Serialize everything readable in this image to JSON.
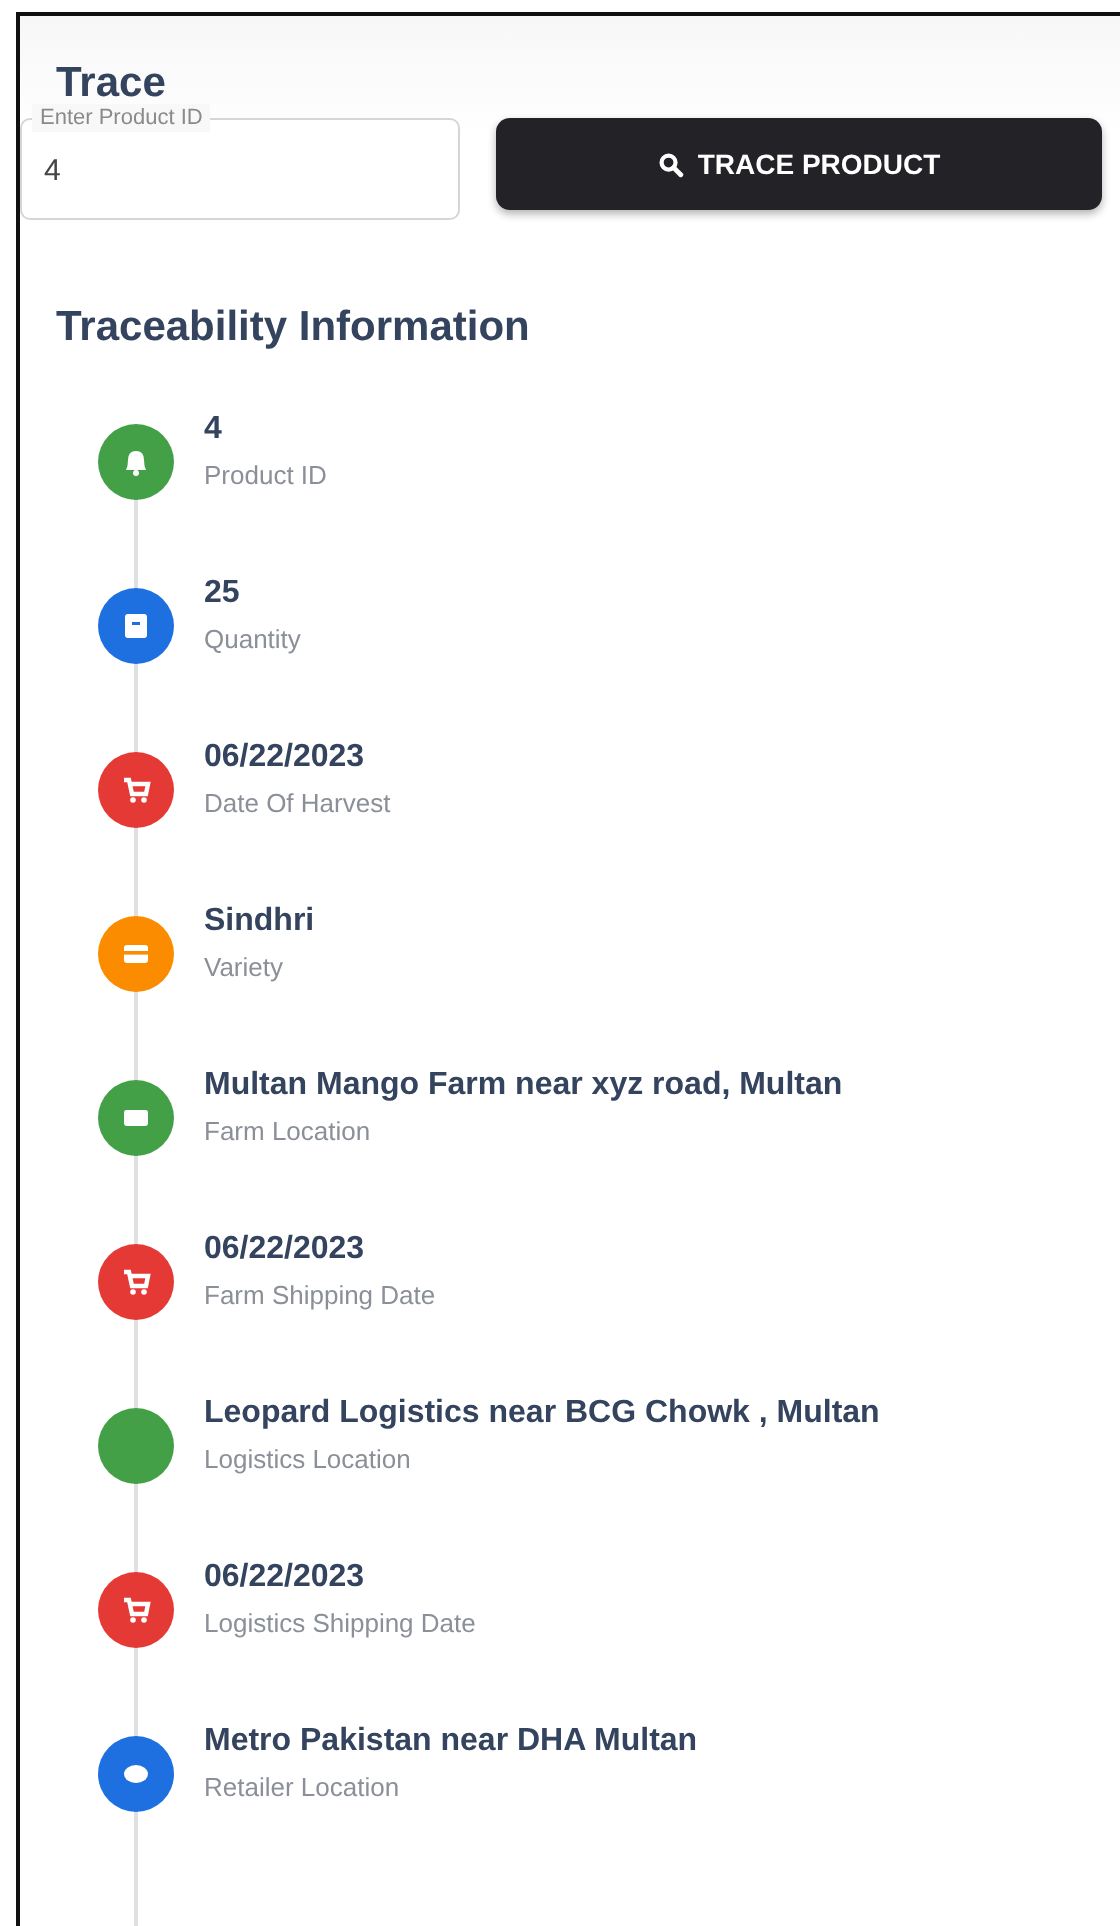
{
  "title": "Trace",
  "search": {
    "label": "Enter Product ID",
    "value": "4",
    "button": "TRACE PRODUCT"
  },
  "heading": "Traceability Information",
  "timeline": [
    {
      "value": "4",
      "label": "Product ID",
      "color": "#43a047",
      "kind": "bell"
    },
    {
      "value": "25",
      "label": "Quantity",
      "color": "#1e6fe0",
      "kind": "archive"
    },
    {
      "value": "06/22/2023",
      "label": "Date Of Harvest",
      "color": "#e53935",
      "kind": "cart"
    },
    {
      "value": "Sindhri",
      "label": "Variety",
      "color": "#fb8c00",
      "kind": "card"
    },
    {
      "value": "Multan Mango Farm near xyz road, Multan",
      "label": "Farm Location",
      "color": "#43a047",
      "kind": "rect"
    },
    {
      "value": "06/22/2023",
      "label": "Farm Shipping Date",
      "color": "#e53935",
      "kind": "cart"
    },
    {
      "value": "Leopard Logistics near BCG Chowk , Multan",
      "label": "Logistics Location",
      "color": "#43a047",
      "kind": "plain"
    },
    {
      "value": "06/22/2023",
      "label": "Logistics Shipping Date",
      "color": "#e53935",
      "kind": "cart"
    },
    {
      "value": "Metro Pakistan near DHA Multan",
      "label": "Retailer Location",
      "color": "#1e6fe0",
      "kind": "oval"
    }
  ]
}
